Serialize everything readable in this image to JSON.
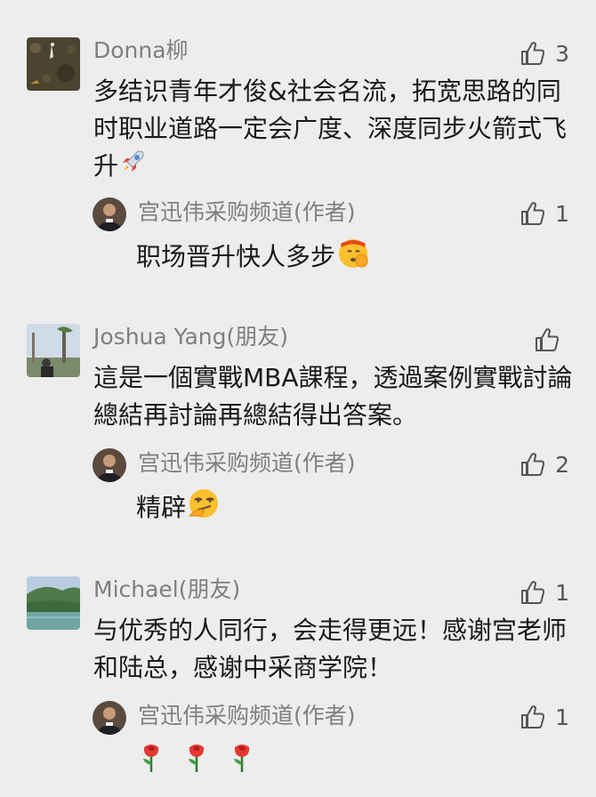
{
  "comments": [
    {
      "author": "Donna柳",
      "likes": "3",
      "text": "多结识青年才俊&社会名流，拓宽思路的同时职业道路一定会广度、深度同步火箭式飞升",
      "emoji": "rocket",
      "reply": {
        "author": "宫迅伟采购频道(作者)",
        "likes": "1",
        "text": "职场晋升快人多步",
        "emoji": "saluting-face"
      }
    },
    {
      "author": "Joshua Yang(朋友)",
      "likes": "",
      "text": "這是一個實戰MBA課程，透過案例實戰討論總結再討論再總結得出答案。",
      "reply": {
        "author": "宫迅伟采购频道(作者)",
        "likes": "2",
        "text": "精辟",
        "emoji": "smirking-face"
      }
    },
    {
      "author": "Michael(朋友)",
      "likes": "1",
      "text": "与优秀的人同行，会走得更远！感谢宫老师和陆总，感谢中采商学院！",
      "reply": {
        "author": "宫迅伟采购频道(作者)",
        "likes": "1",
        "text": "",
        "emoji": "rose x3"
      }
    }
  ],
  "colors": {
    "background": "#ededed",
    "name": "#7f7f7f",
    "text": "#1a1a1a",
    "icon": "#555555"
  }
}
